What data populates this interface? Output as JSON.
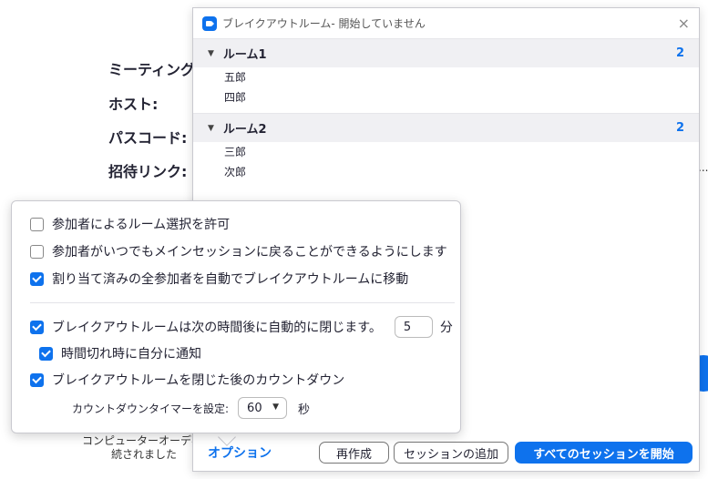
{
  "background": {
    "meeting_topic_label": "ミーティング ト",
    "host_label": "ホスト:",
    "passcode_label": "パスコード:",
    "invite_link_label": "招待リンク:",
    "computer_audio_partial": "コンピューターオーディ",
    "connected_partial": "続されました",
    "partial_right_text": "..."
  },
  "breakout": {
    "title": "ブレイクアウトルーム- 開始していません",
    "close_icon": "×",
    "rooms": [
      {
        "name": "ルーム1",
        "count": "2",
        "members": [
          "五郎",
          "四郎"
        ]
      },
      {
        "name": "ルーム2",
        "count": "2",
        "members": [
          "三郎",
          "次郎"
        ]
      }
    ],
    "chevron": "▼"
  },
  "options": {
    "allow_choose": {
      "label": "参加者によるルーム選択を許可",
      "checked": false
    },
    "allow_return": {
      "label": "参加者がいつでもメインセッションに戻ることができるようにします",
      "checked": false
    },
    "auto_move": {
      "label": "割り当て済みの全参加者を自動でブレイクアウトルームに移動",
      "checked": true
    },
    "auto_close": {
      "label": "ブレイクアウトルームは次の時間後に自動的に閉じます。",
      "checked": true,
      "minutes": "5",
      "unit": "分"
    },
    "notify_me": {
      "label": "時間切れ時に自分に通知",
      "checked": true
    },
    "countdown": {
      "label": "ブレイクアウトルームを閉じた後のカウントダウン",
      "checked": true
    },
    "countdown_timer": {
      "label": "カウントダウンタイマーを設定:",
      "value": "60",
      "unit": "秒"
    }
  },
  "bottom": {
    "options_link": "オプション",
    "recreate": "再作成",
    "add_session": "セッションの追加",
    "start_all": "すべてのセッションを開始"
  },
  "colors": {
    "accent": "#0e72ed"
  }
}
